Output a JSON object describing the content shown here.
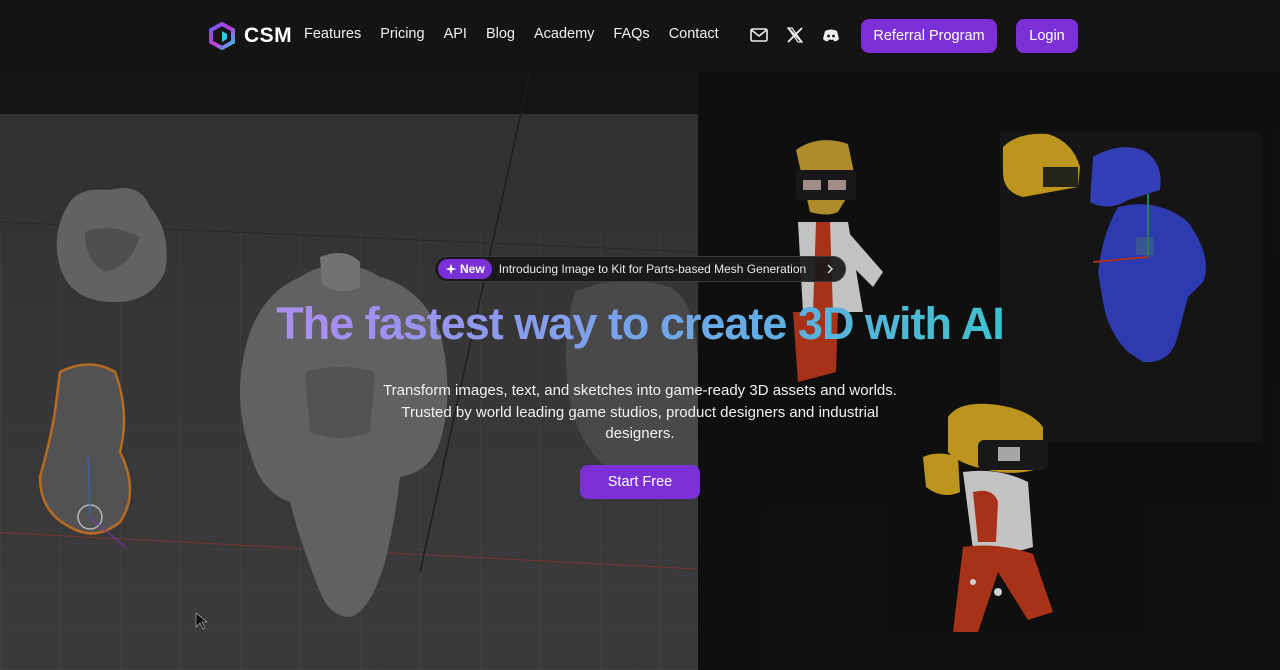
{
  "brand": {
    "name": "CSM",
    "logo_icon": "csm-hexagon-logo"
  },
  "nav": {
    "links": [
      "Features",
      "Pricing",
      "API",
      "Blog",
      "Academy",
      "FAQs",
      "Contact"
    ],
    "icons": [
      "mail-icon",
      "x-icon",
      "discord-icon"
    ],
    "referral_label": "Referral Program",
    "login_label": "Login"
  },
  "hero": {
    "announcement": {
      "badge": "New",
      "text": "Introducing Image to Kit for Parts-based Mesh Generation"
    },
    "headline": "The fastest way to create 3D with AI",
    "subline": "Transform  images, text, and sketches into game-ready 3D assets and worlds. Trusted by world leading game studios, product designers and industrial designers.",
    "cta_label": "Start Free"
  },
  "colors": {
    "accent": "#7b2fd6",
    "headline_gradient_start": "#b98ef0",
    "headline_gradient_end": "#2fc8c4",
    "background": "#0e0e0f"
  }
}
